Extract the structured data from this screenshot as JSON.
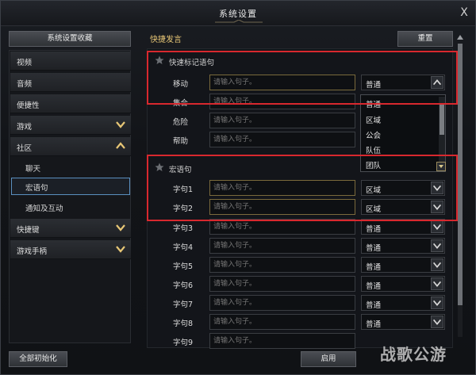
{
  "window": {
    "title": "系统设置",
    "close_glyph": "X"
  },
  "sidebar": {
    "header_button": "系统设置收藏",
    "items": [
      {
        "label": "视频",
        "chevron": ""
      },
      {
        "label": "音频",
        "chevron": ""
      },
      {
        "label": "便捷性",
        "chevron": ""
      },
      {
        "label": "游戏",
        "chevron": "down"
      },
      {
        "label": "社区",
        "chevron": "up"
      },
      {
        "label": "聊天"
      },
      {
        "label": "宏语句",
        "selected": true
      },
      {
        "label": "通知及互动"
      },
      {
        "label": "快捷键",
        "chevron": "down"
      },
      {
        "label": "游戏手柄",
        "chevron": "down"
      }
    ],
    "reset_all_button": "全部初始化"
  },
  "main": {
    "section_title": "快捷发言",
    "reset_button": "重置",
    "apply_button": "启用",
    "marker_group": {
      "title": "快速标记语句",
      "rows": [
        {
          "label": "移动",
          "placeholder": "请输入句子。",
          "channel": "普通"
        },
        {
          "label": "集合",
          "placeholder": "请输入句子。",
          "channel": "普通"
        },
        {
          "label": "危险",
          "placeholder": "请输入句子。"
        },
        {
          "label": "帮助",
          "placeholder": "请输入句子。"
        }
      ]
    },
    "dropdown_options": [
      "普通",
      "区域",
      "公会",
      "队伍",
      "团队"
    ],
    "macro_group": {
      "title": "宏语句",
      "rows": [
        {
          "label": "字句1",
          "placeholder": "请输入句子。",
          "channel": "区域"
        },
        {
          "label": "字句2",
          "placeholder": "请输入句子。",
          "channel": "区域"
        },
        {
          "label": "字句3",
          "placeholder": "请输入句子。",
          "channel": "普通"
        },
        {
          "label": "字句4",
          "placeholder": "请输入句子。",
          "channel": "普通"
        },
        {
          "label": "字句5",
          "placeholder": "请输入句子。",
          "channel": "普通"
        },
        {
          "label": "字句6",
          "placeholder": "请输入句子。",
          "channel": "普通"
        },
        {
          "label": "字句7",
          "placeholder": "请输入句子。",
          "channel": "普通"
        },
        {
          "label": "字句8",
          "placeholder": "请输入句子。",
          "channel": "普通"
        },
        {
          "label": "字句9",
          "placeholder": "请输入句子。"
        }
      ]
    }
  },
  "watermark": "战歌公游",
  "colors": {
    "accent_gold": "#e8c776",
    "highlight_red": "#d8282e",
    "selected_blue": "#5a8fbf"
  }
}
